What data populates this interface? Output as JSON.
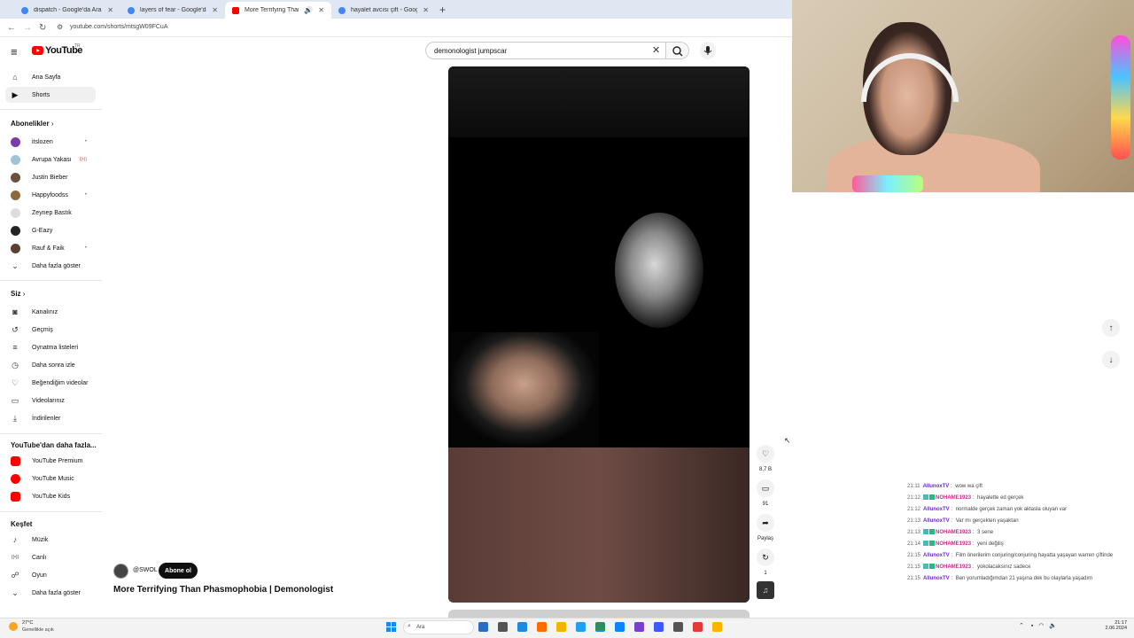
{
  "browser": {
    "tabs": [
      {
        "title": "dispatch - Google'da Ara",
        "active": false,
        "favicon_color": "#4285f4"
      },
      {
        "title": "layers of fear - Google'da Ara",
        "active": false,
        "favicon_color": "#4285f4"
      },
      {
        "title": "More Terrifying Than Phasm",
        "active": true,
        "favicon_color": "#ff0000"
      },
      {
        "title": "hayalet avcısı çift - Google'da A",
        "active": false,
        "favicon_color": "#4285f4"
      }
    ],
    "new_tab": "+",
    "url": "youtube.com/shorts/mtsgW09FCuA"
  },
  "header": {
    "logo_text": "YouTube",
    "logo_country": "TR",
    "search_value": "demonologist jumpscar"
  },
  "sidebar": {
    "main": [
      {
        "label": "Ana Sayfa",
        "icon": "home-icon",
        "glyph": "⌂"
      },
      {
        "label": "Shorts",
        "icon": "shorts-icon",
        "glyph": "▶",
        "active": true
      }
    ],
    "subs_title": "Abonelikler",
    "subs": [
      {
        "label": "itslozen",
        "color": "#7b3ca8",
        "dot": "•"
      },
      {
        "label": "Avrupa Yakası",
        "color": "#9fc4d8",
        "dot": "((•))"
      },
      {
        "label": "Justin Bieber",
        "color": "#6b5040",
        "dot": ""
      },
      {
        "label": "Happyfoodss",
        "color": "#8a6a3a",
        "dot": "•"
      },
      {
        "label": "Zeynep Bastık",
        "color": "#ddd",
        "dot": ""
      },
      {
        "label": "G-Eazy",
        "color": "#222",
        "dot": ""
      },
      {
        "label": "Rauf & Faik",
        "color": "#5a4030",
        "dot": "•"
      },
      {
        "label": "Daha fazla göster",
        "color": "",
        "dot": "",
        "is_more": true
      }
    ],
    "you_title": "Siz",
    "you": [
      {
        "label": "Kanalınız",
        "glyph": "◙"
      },
      {
        "label": "Geçmiş",
        "glyph": "↺"
      },
      {
        "label": "Oynatma listeleri",
        "glyph": "≡"
      },
      {
        "label": "Daha sonra izle",
        "glyph": "◷"
      },
      {
        "label": "Beğendiğim videolar",
        "glyph": "♡"
      },
      {
        "label": "Videolarınız",
        "glyph": "▭"
      },
      {
        "label": "İndirilenler",
        "glyph": "⤓"
      }
    ],
    "more_title": "YouTube'dan daha fazla...",
    "more": [
      {
        "label": "YouTube Premium",
        "color": "#ff0000"
      },
      {
        "label": "YouTube Music",
        "color": "#ff0000"
      },
      {
        "label": "YouTube Kids",
        "color": "#ff0000"
      }
    ],
    "explore_title": "Keşfet",
    "explore": [
      {
        "label": "Müzik",
        "glyph": "♪"
      },
      {
        "label": "Canlı",
        "glyph": "((•))"
      },
      {
        "label": "Oyun",
        "glyph": "☍"
      },
      {
        "label": "Daha fazla göster",
        "glyph": "⌄"
      }
    ]
  },
  "video": {
    "channel": "@SWOL",
    "subscribe_label": "Abone ol",
    "title": "More Terrifying Than Phasmophobia | Demonologist"
  },
  "actions": {
    "like_count": "8,7 B",
    "comment_count": "91",
    "share_label": "Paylaş",
    "remix_count": "1"
  },
  "chat": [
    {
      "time": "21:11",
      "user": "AllunoxTV",
      "badges": false,
      "style": "u1",
      "message": "wow wa çift"
    },
    {
      "time": "21:12",
      "user": "NOHAME1923",
      "badges": true,
      "style": "u2",
      "message": "hayalette ed gerçek"
    },
    {
      "time": "21:12",
      "user": "AllunoxTV",
      "badges": false,
      "style": "u1",
      "message": "normalde gerçek zaman yok aktasla oluyan var"
    },
    {
      "time": "21:13",
      "user": "AllunoxTV",
      "badges": false,
      "style": "u1",
      "message": "Var mı gerçekten yaşaktan"
    },
    {
      "time": "21:13",
      "user": "NOHAME1923",
      "badges": true,
      "style": "u2",
      "message": "3 sene"
    },
    {
      "time": "21:14",
      "user": "NOHAME1923",
      "badges": true,
      "style": "u2",
      "message": "yeni değiliş"
    },
    {
      "time": "21:15",
      "user": "AllunoxTV",
      "badges": false,
      "style": "u1",
      "message": "Film önerilerim conjuring/conjuring hayatta yaşayan warren çiftinde"
    },
    {
      "time": "21:15",
      "user": "NOHAME1923",
      "badges": true,
      "style": "u2",
      "message": "yokolacaksınız sadece"
    },
    {
      "time": "21:15",
      "user": "AllunoxTV",
      "badges": false,
      "style": "u1",
      "message": "Ben yorumladığımdan 21 yaşına dek bu olaylarla yaşadım"
    }
  ],
  "taskbar": {
    "temp": "27°C",
    "weather": "Genellikle açık",
    "search": "Ara",
    "time": "21:17",
    "date": "2.06.2024",
    "apps": [
      "#2b6cc4",
      "#555",
      "#1e88e5",
      "#ff6d00",
      "#f4b400",
      "#1da1f2",
      "#2f8f5b",
      "#0a84ff",
      "#7a3fd1",
      "#3d5afe",
      "#555",
      "#e53935",
      "#ffb300"
    ]
  }
}
